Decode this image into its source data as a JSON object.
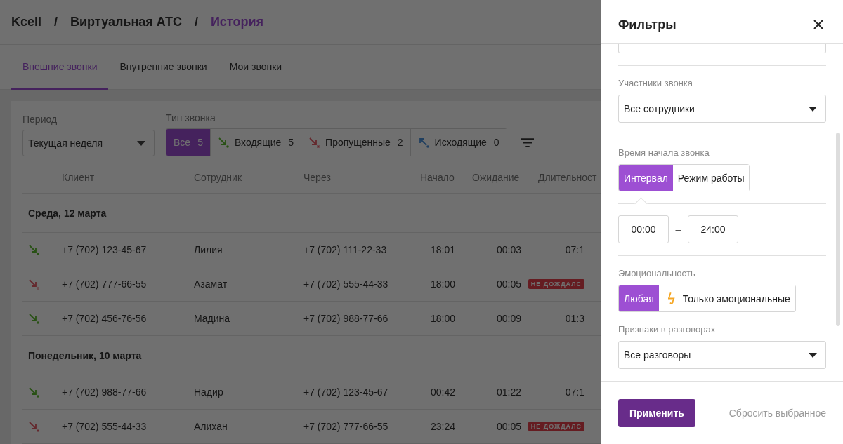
{
  "breadcrumb": {
    "separator": "/",
    "items": [
      {
        "label": "Kcell",
        "current": false
      },
      {
        "label": "Виртуальная АТС",
        "current": false
      },
      {
        "label": "История",
        "current": true
      }
    ]
  },
  "tabs": [
    {
      "label": "Внешние звонки",
      "selected": true
    },
    {
      "label": "Внутренние звонки",
      "selected": false
    },
    {
      "label": "Мои звонки",
      "selected": false
    }
  ],
  "period": {
    "label": "Период",
    "value": "Текущая неделя"
  },
  "call_type": {
    "label": "Тип звонка",
    "options": [
      {
        "kind": "all",
        "label": "Все",
        "count": "5",
        "selected": true
      },
      {
        "kind": "incoming",
        "label": "Входящие",
        "count": "5",
        "selected": false
      },
      {
        "kind": "missed",
        "label": "Пропущенные",
        "count": "2",
        "selected": false
      },
      {
        "kind": "outgoing",
        "label": "Исходящие",
        "count": "0",
        "selected": false
      }
    ]
  },
  "table": {
    "columns": [
      "Клиент",
      "Сотрудник",
      "Через",
      "Начало",
      "Ожидание",
      "Длительност"
    ],
    "groups": [
      {
        "date": "Среда, 12 марта",
        "rows": [
          {
            "kind": "incoming",
            "client": "+7 (702) 123-45-67",
            "employee": "Лилия",
            "via": "+7 (702) 111-22-33",
            "start": "18:01",
            "wait": "00:03",
            "duration": "07:1"
          },
          {
            "kind": "missed",
            "client": "+7 (702) 777-66-55",
            "employee": "Азамат",
            "via": "+7 (702) 555-44-33",
            "start": "18:00",
            "wait": "00:05",
            "badge": "НЕ ДОЖДАЛС"
          },
          {
            "kind": "incoming",
            "client": "+7 (702) 456-76-56",
            "employee": "Мадина",
            "via": "+7 (702) 988-77-66",
            "start": "18:00",
            "wait": "00:09",
            "duration": "01:3"
          }
        ]
      },
      {
        "date": "Понедельник, 10 марта",
        "rows": [
          {
            "kind": "incoming",
            "client": "+7 (702) 988-77-66",
            "employee": "Надир",
            "via": "+7 (702) 123-45-67",
            "start": "00:42",
            "wait": "01:22",
            "duration": "07:1"
          },
          {
            "kind": "missed",
            "client": "+7 (702) 555-44-33",
            "employee": "Алихан",
            "via": "+7 (702) 777-66-55",
            "start": "23:24",
            "wait": "00:05",
            "badge": "НЕ ДОЖДАЛС"
          }
        ]
      }
    ]
  },
  "filters_panel": {
    "title": "Фильтры",
    "participants": {
      "label": "Участники звонка",
      "value": "Все сотрудники"
    },
    "start_time": {
      "label": "Время начала звонка",
      "modes": [
        {
          "label": "Интервал",
          "selected": true
        },
        {
          "label": "Режим работы",
          "selected": false
        }
      ],
      "from": "00:00",
      "separator": "–",
      "to": "24:00"
    },
    "emotion": {
      "label": "Эмоциональность",
      "options": [
        {
          "kind": "any",
          "label": "Любая",
          "selected": true
        },
        {
          "kind": "emotional",
          "label": "Только эмоциональные",
          "selected": false
        }
      ]
    },
    "features": {
      "label": "Признаки в разговорах",
      "value": "Все разговоры"
    },
    "apply": "Применить",
    "reset": "Сбросить выбранное"
  }
}
